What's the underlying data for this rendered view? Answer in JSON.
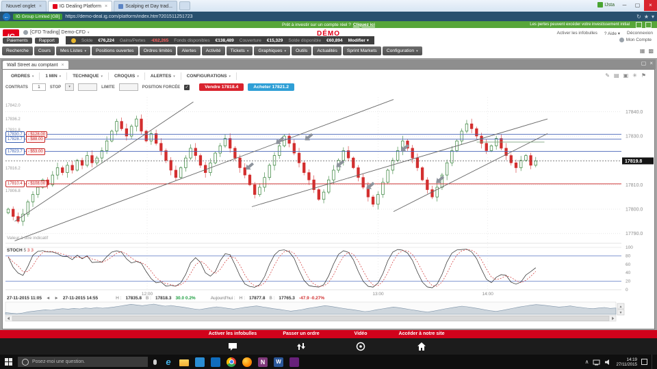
{
  "colors": {
    "brand_red": "#e2001a",
    "sell_red": "#d9232e",
    "buy_blue": "#2f9fd6",
    "promo_green": "#57a639",
    "up": "#2e7d32",
    "down": "#d32f2f"
  },
  "browser": {
    "tabs": [
      {
        "label": "Nouvel onglet"
      },
      {
        "label": "IG Dealing Platform",
        "active": true
      },
      {
        "label": "Scalping et Day trad..."
      }
    ],
    "badge": "IJsta",
    "cert": "IG Group Limited [GB]",
    "url": "https://demo-deal.ig.com/platform/index.htm?201511251723"
  },
  "promo": {
    "question": "Prêt à investir sur un compte réel ?",
    "link": "Cliquez ici",
    "warning": "Les pertes peuvent excéder votre investissement initial"
  },
  "header": {
    "logo": "IG",
    "account": "[CFD Trading] Demo-CFD",
    "demo": "DÉMO",
    "infobulles": "Activer les infobulles",
    "aide": "? Aide",
    "deconnexion": "Déconnexion"
  },
  "accountbar": {
    "paiements": "Paiements",
    "rapport": "Rapport",
    "balances": [
      {
        "label": "Solde",
        "value": "€76,224"
      },
      {
        "label": "Gains/Pertes",
        "value": "-€62,265",
        "neg": true
      },
      {
        "label": "Fonds disponibles",
        "value": "€138,489"
      },
      {
        "label": "Couverture",
        "value": "€15,329"
      },
      {
        "label": "Solde disponible",
        "value": "€60,894"
      }
    ],
    "modifier": "Modifier",
    "mon_compte": "Mon Compte"
  },
  "menu": {
    "items": [
      {
        "label": "Recherche"
      },
      {
        "label": "Cours"
      },
      {
        "label": "Mes Listes",
        "caret": true
      },
      {
        "label": "Positions ouvertes"
      },
      {
        "label": "Ordres limités"
      },
      {
        "label": "Alertes"
      },
      {
        "label": "Activité"
      },
      {
        "label": "Tickets",
        "caret": true
      },
      {
        "label": "Graphiques",
        "caret": true
      },
      {
        "label": "Outils"
      },
      {
        "label": "Actualités"
      },
      {
        "label": "Sprint Markets"
      },
      {
        "label": "Configuration",
        "caret": true
      }
    ]
  },
  "workspace": {
    "tab": "Wall Street au comptant"
  },
  "chart_toolbar": {
    "items": [
      {
        "label": "ORDRES"
      },
      {
        "label": "1 MIN"
      },
      {
        "label": "TECHNIQUE"
      },
      {
        "label": "CROQUIS"
      },
      {
        "label": "ALERTES"
      },
      {
        "label": "CONFIGURATIONS"
      }
    ]
  },
  "order_bar": {
    "contrats": "CONTRATS",
    "contrats_value": "1",
    "stop": "STOP",
    "limite": "LIMITE",
    "position_forcee": "POSITION FORCÉE",
    "sell_label": "Vendre",
    "sell_price": "17818.4",
    "buy_label": "Acheter",
    "buy_price": "17821.2"
  },
  "chart_data": {
    "type": "candlestick",
    "instrument": "Wall Street au comptant",
    "interval": "1 MIN",
    "price_range": [
      17786,
      17846
    ],
    "current_price": 17819.8,
    "y_ticks": [
      17840,
      17830,
      17820,
      17810,
      17800,
      17790
    ],
    "x_ticks": [
      {
        "label": "12:00",
        "f": 0.23
      },
      {
        "label": "13:00",
        "f": 0.605
      },
      {
        "label": "14:00",
        "f": 0.783
      }
    ],
    "left_levels": [
      {
        "price": 17842.0,
        "type": "plain"
      },
      {
        "price": 17836.2,
        "type": "plain"
      },
      {
        "price": 17831.8,
        "type": "plain"
      },
      {
        "price": 17830.7,
        "amount": "- $128.00",
        "type": "order-blue"
      },
      {
        "price": 17828.7,
        "amount": "- $88.00",
        "type": "order-blue"
      },
      {
        "price": 17823.7,
        "amount": "- $53.00",
        "type": "order-blue"
      },
      {
        "price": 17816.2,
        "type": "plain"
      },
      {
        "price": 17810.4,
        "amount": "- $108.00",
        "type": "order-red"
      },
      {
        "price": 17806.8,
        "type": "plain"
      }
    ],
    "closes": [
      17800,
      17797,
      17795,
      17798,
      17803,
      17806,
      17809,
      17812,
      17810,
      17814,
      17817,
      17815,
      17818,
      17816,
      17820,
      17818,
      17822,
      17819,
      17821,
      17824,
      17828,
      17832,
      17836,
      17833,
      17830,
      17834,
      17837,
      17832,
      17828,
      17831,
      17827,
      17824,
      17820,
      17816,
      17813,
      17817,
      17821,
      17825,
      17822,
      17818,
      17815,
      17819,
      17823,
      17826,
      17829,
      17825,
      17821,
      17817,
      17814,
      17810,
      17806,
      17809,
      17813,
      17818,
      17822,
      17826,
      17830,
      17827,
      17823,
      17819,
      17815,
      17812,
      17808,
      17804,
      17807,
      17812,
      17816,
      17820,
      17824,
      17821,
      17817,
      17813,
      17809,
      17805,
      17802,
      17806,
      17811,
      17816,
      17820,
      17824,
      17828,
      17825,
      17821,
      17817,
      17812,
      17808,
      17805,
      17809,
      17814,
      17819,
      17824,
      17828,
      17832,
      17835,
      17833,
      17830,
      17827,
      17824,
      17826,
      17829,
      17825,
      17822,
      17819,
      17817,
      17820,
      17822,
      17818,
      17819.8
    ],
    "sketch_lines": [
      {
        "x1": 0.015,
        "p1": 17795,
        "x2": 0.305,
        "p2": 17844
      },
      {
        "x1": 0.015,
        "p1": 17787,
        "x2": 0.63,
        "p2": 17845
      },
      {
        "x1": 0.4,
        "p1": 17801,
        "x2": 0.88,
        "p2": 17837
      },
      {
        "x1": 0.63,
        "p1": 17799,
        "x2": 0.88,
        "p2": 17831
      },
      {
        "x1": 0.765,
        "p1": 17827.5,
        "x2": 0.875,
        "p2": 17827.5,
        "c": "#7da37d"
      }
    ],
    "sketch_arrows": [
      {
        "x": 0.396,
        "p": 17817.5,
        "a": 140
      },
      {
        "x": 0.445,
        "p": 17828,
        "a": 140
      },
      {
        "x": 0.492,
        "p": 17829.5,
        "a": 140
      },
      {
        "x": 0.543,
        "p": 17818.5,
        "a": 140
      },
      {
        "x": 0.592,
        "p": 17809.5,
        "a": 140
      },
      {
        "x": 0.648,
        "p": 17825,
        "a": 140
      },
      {
        "x": 0.705,
        "p": 17812,
        "a": 140
      }
    ],
    "stoch": {
      "label": "STOCH",
      "params_k": "5",
      "params_d": "3 3",
      "levels": [
        80,
        20
      ],
      "y_ticks": [
        100,
        80,
        60,
        40,
        20,
        0
      ]
    },
    "info": {
      "from": "27-11-2015 11:05",
      "to": "27-11-2015 14:55",
      "h_label": "H :",
      "h": "17835.8",
      "b_label": "B :",
      "b": "17818.3",
      "change": "30.0  0.2%",
      "today_label": "Aujourd'hui :",
      "today_h_label": "H :",
      "today_h": "17877.8",
      "today_b_label": "B :",
      "today_b": "17765.3",
      "today_change": "-47.9  -0.27%"
    },
    "indicatif": "Valeur à titre indicatif"
  },
  "footer": {
    "actions": [
      {
        "label": "Activer les infobulles",
        "icon": "chat"
      },
      {
        "label": "Passer un ordre",
        "icon": "order"
      },
      {
        "label": "Vidéo",
        "icon": "video"
      },
      {
        "label": "Accéder à notre site",
        "icon": "home"
      }
    ]
  },
  "taskbar": {
    "search": "Posez-moi une question.",
    "apps": [
      "ie",
      "explorer",
      "mail",
      "store",
      "chrome",
      "firefox",
      "onenote",
      "word",
      "vs"
    ],
    "time": "14:19",
    "date": "27/11/2015"
  }
}
